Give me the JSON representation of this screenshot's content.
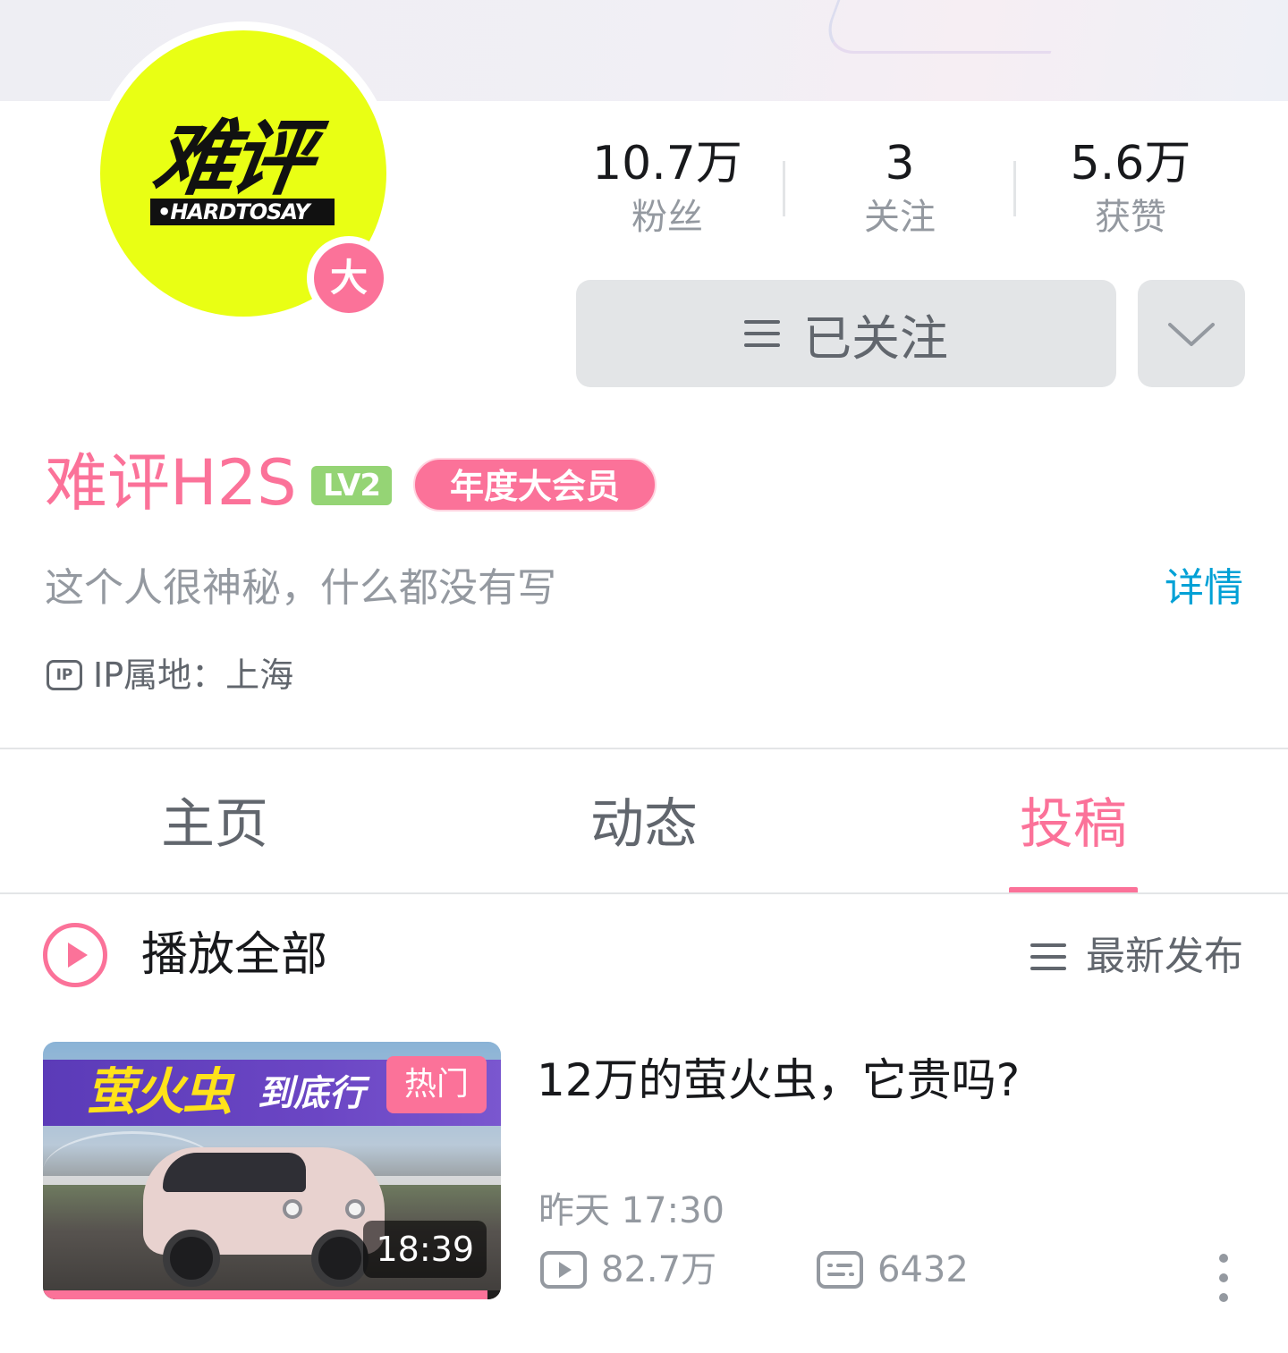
{
  "profile": {
    "avatar_logo_cn": "难评",
    "avatar_logo_en": "•HARDTOSAY",
    "big_member_badge": "大",
    "name": "难评H2S",
    "level": "LV2",
    "vip_label": "年度大会员",
    "bio": "这个人很神秘，什么都没有写",
    "detail_link": "详情",
    "ip_icon": "IP",
    "ip_location": "IP属地：上海"
  },
  "stats": [
    {
      "value": "10.7万",
      "label": "粉丝"
    },
    {
      "value": "3",
      "label": "关注"
    },
    {
      "value": "5.6万",
      "label": "获赞"
    }
  ],
  "actions": {
    "followed_label": "已关注",
    "more_icon": "chevron-down-icon"
  },
  "tabs": [
    {
      "label": "主页",
      "active": false
    },
    {
      "label": "动态",
      "active": false
    },
    {
      "label": "投稿",
      "active": true
    }
  ],
  "list_header": {
    "play_all_label": "播放全部",
    "sort_label": "最新发布"
  },
  "videos": [
    {
      "thumb_text_a": "萤火虫",
      "thumb_text_b": "到底行",
      "hot_badge": "热门",
      "duration": "18:39",
      "watched_fraction": 0.97,
      "title": "12万的萤火虫，它贵吗?",
      "publish_time": "昨天 17:30",
      "views": "82.7万",
      "danmaku": "6432"
    }
  ],
  "colors": {
    "accent_pink": "#fb7299",
    "link_blue": "#00a1d6",
    "level_green": "#95d475",
    "avatar_yellow": "#e9ff14"
  }
}
